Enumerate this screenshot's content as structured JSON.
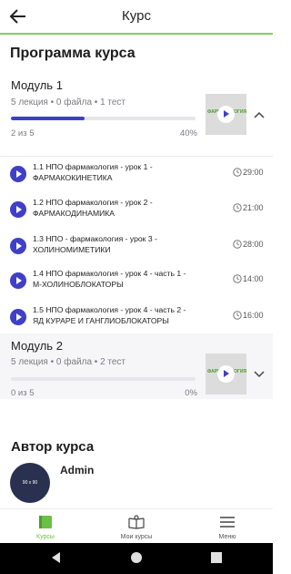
{
  "header": {
    "title": "Курс"
  },
  "program": {
    "heading": "Программа курса"
  },
  "modules": [
    {
      "title": "Модуль 1",
      "meta": "5 лекция • 0 файла • 1 тест",
      "progress_text": "2 из 5",
      "percent_text": "40%",
      "progress": 0.4,
      "expanded": true
    },
    {
      "title": "Модуль 2",
      "meta": "5 лекция • 0 файла • 2 тест",
      "progress_text": "0 из 5",
      "percent_text": "0%",
      "progress": 0.0,
      "expanded": false
    }
  ],
  "lessons": [
    {
      "title": "1.1 НПО фармакология - урок 1 - ФАРМАКОКИНЕТИКА",
      "duration": "29:00"
    },
    {
      "title": "1.2 НПО фармакология - урок 2 - ФАРМАКОДИНАМИКА",
      "duration": "21:00"
    },
    {
      "title": "1.3 НПО - фармакология - урок 3 - ХОЛИНОМИМЕТИКИ",
      "duration": "28:00"
    },
    {
      "title": "1.4 НПО фармакология - урок 4 - часть 1 - М-ХОЛИНОБЛОКАТОРЫ",
      "duration": "14:00"
    },
    {
      "title": "1.5 НПО фармакология - урок 4 - часть 2 - ЯД КУРАРЕ И ГАНГЛИОБЛОКАТОРЫ",
      "duration": "16:00"
    }
  ],
  "author": {
    "heading": "Автор курса",
    "name": "Admin",
    "avatar_text": "90 x 90"
  },
  "bottom_nav": [
    {
      "label": "Курсы",
      "icon": "courses-icon",
      "active": true
    },
    {
      "label": "Мои курсы",
      "icon": "book-icon",
      "active": false
    },
    {
      "label": "Меню",
      "icon": "menu-icon",
      "active": false
    }
  ],
  "colors": {
    "accent": "#3f3fc8",
    "brand_green": "#6abf47",
    "avatar_bg": "#2a3150"
  }
}
